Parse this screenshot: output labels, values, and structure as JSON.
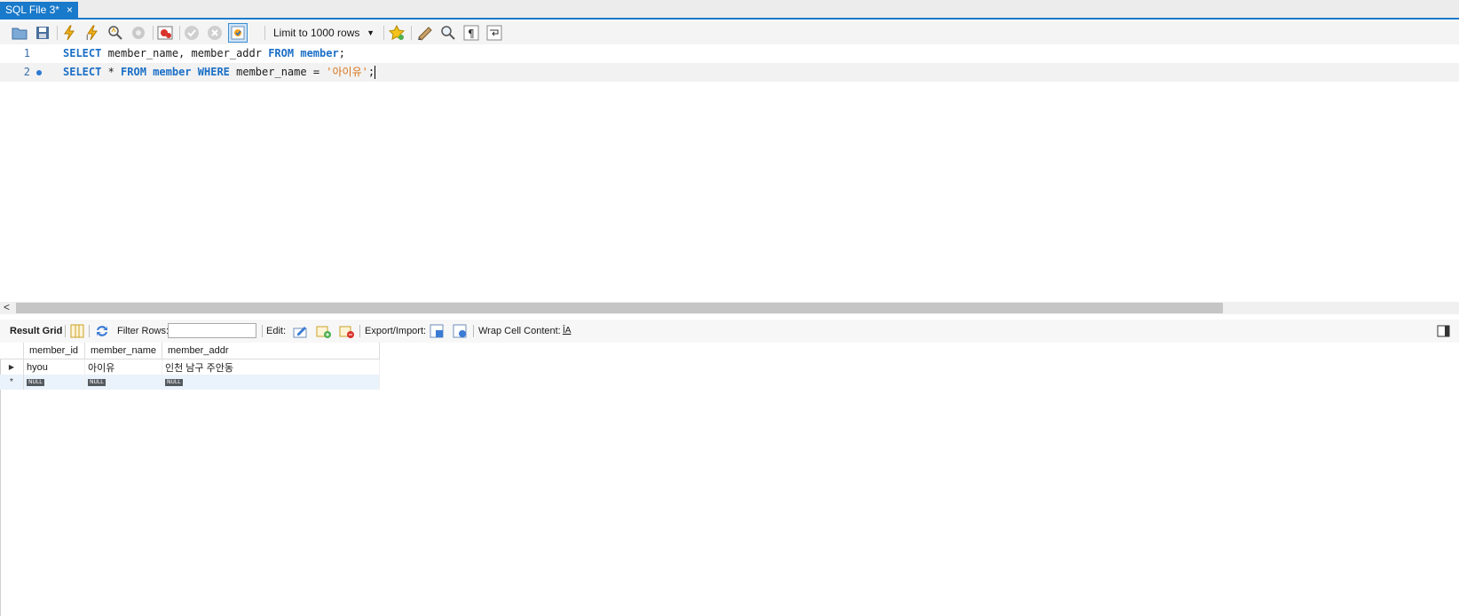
{
  "tab": {
    "label": "SQL File 3*",
    "close": "×"
  },
  "toolbar": {
    "limit_rows": "Limit to 1000 rows",
    "icons": [
      "open-folder-icon",
      "save-icon",
      "execute-icon",
      "execute-current-icon",
      "explain-icon",
      "stop-icon",
      "toggle-error-icon",
      "commit-icon",
      "rollback-icon",
      "autocommit-icon",
      "bookmark-icon",
      "beautify-icon",
      "find-icon",
      "invisible-chars-icon",
      "word-wrap-icon"
    ]
  },
  "editor": {
    "lines": [
      {
        "number": "1",
        "tokens": [
          {
            "t": "kw",
            "v": "SELECT"
          },
          {
            "t": "id",
            "v": " member_name, member_addr "
          },
          {
            "t": "kw",
            "v": "FROM"
          },
          {
            "t": "id",
            "v": " "
          },
          {
            "t": "kw",
            "v": "member"
          },
          {
            "t": "id",
            "v": ";"
          }
        ]
      },
      {
        "number": "2",
        "tokens": [
          {
            "t": "kw",
            "v": "SELECT"
          },
          {
            "t": "id",
            "v": " * "
          },
          {
            "t": "kw",
            "v": "FROM"
          },
          {
            "t": "id",
            "v": " "
          },
          {
            "t": "kw",
            "v": "member"
          },
          {
            "t": "id",
            "v": " "
          },
          {
            "t": "kw",
            "v": "WHERE"
          },
          {
            "t": "id",
            "v": " member_name = "
          },
          {
            "t": "str",
            "v": "'아이유'"
          },
          {
            "t": "id",
            "v": ";"
          }
        ]
      }
    ]
  },
  "result": {
    "result_grid_label": "Result Grid",
    "filter_label": "Filter Rows:",
    "filter_value": "",
    "edit_label": "Edit:",
    "export_label": "Export/Import:",
    "wrap_label": "Wrap Cell Content:",
    "wrap_icon_text": "ĪA",
    "columns": [
      "member_id",
      "member_name",
      "member_addr"
    ],
    "rows": [
      {
        "marker": "▶",
        "cells": [
          "hyou",
          "아이유",
          "인천 남구 주안동"
        ]
      }
    ],
    "new_row": {
      "marker": "*",
      "cells": [
        "NULL",
        "NULL",
        "NULL"
      ]
    }
  }
}
